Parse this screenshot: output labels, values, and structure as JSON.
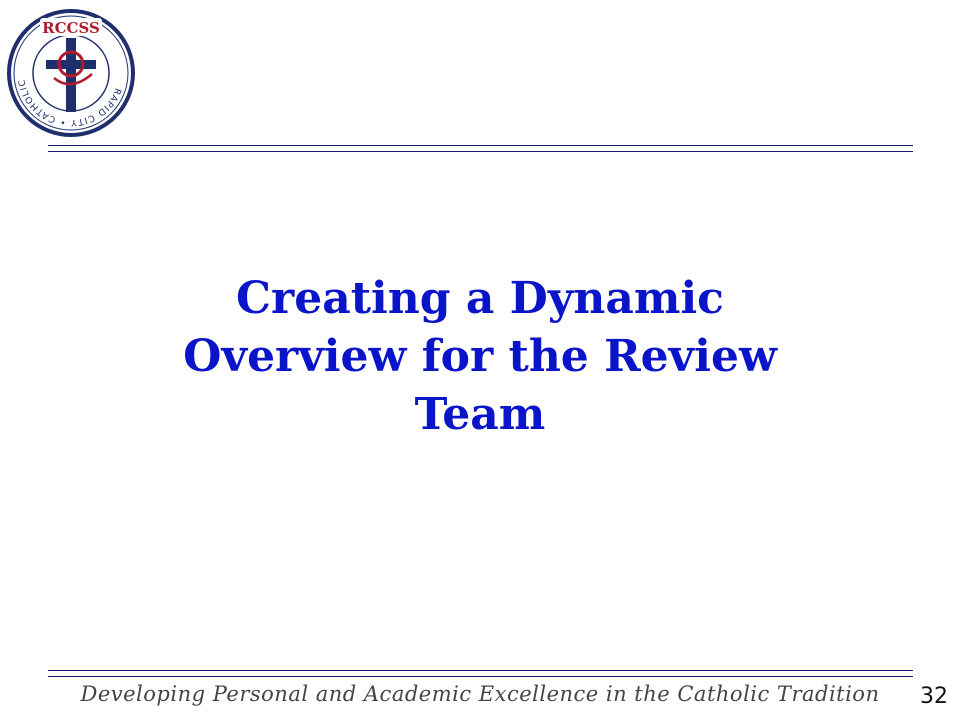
{
  "logo": {
    "acronym": "RCCSS",
    "ring_text": "RAPID CITY • CATHOLIC • SCHOOL • SYSTEM"
  },
  "title_lines": [
    "Creating a Dynamic",
    "Overview for the Review",
    "Team"
  ],
  "footer": {
    "tagline": "Developing Personal and Academic Excellence in the Catholic Tradition",
    "page_number": "32"
  },
  "colors": {
    "title": "#0a14c8",
    "rule": "#1a1a6e",
    "logo_navy": "#1f2f6e",
    "logo_red": "#b01c2e"
  }
}
